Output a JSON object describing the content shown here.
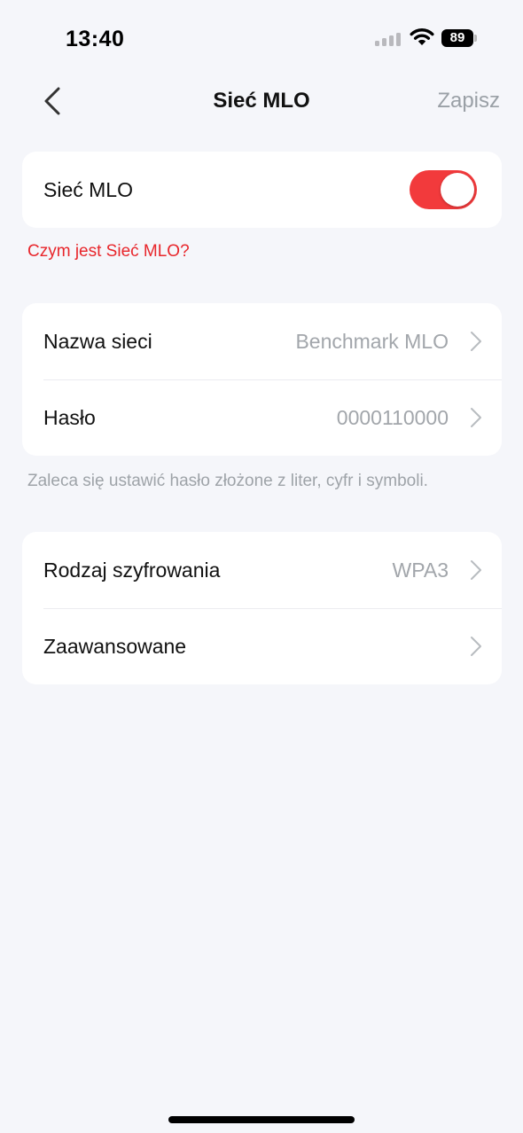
{
  "status_bar": {
    "time": "13:40",
    "battery": "89"
  },
  "nav": {
    "title": "Sieć MLO",
    "save_label": "Zapisz"
  },
  "mlo_card": {
    "label": "Sieć MLO",
    "enabled": true,
    "toggle_color": "#f23a3c"
  },
  "help_link": "Czym jest Sieć MLO?",
  "network_card": {
    "rows": [
      {
        "label": "Nazwa sieci",
        "value": "Benchmark MLO"
      },
      {
        "label": "Hasło",
        "value": "0000110000"
      }
    ]
  },
  "password_hint": "Zaleca się ustawić hasło złożone z liter, cyfr i symboli.",
  "security_card": {
    "rows": [
      {
        "label": "Rodzaj szyfrowania",
        "value": "WPA3"
      },
      {
        "label": "Zaawansowane",
        "value": ""
      }
    ]
  },
  "colors": {
    "accent": "#e8262b",
    "background": "#f5f6fa",
    "secondary_text": "#a2a6ab"
  }
}
